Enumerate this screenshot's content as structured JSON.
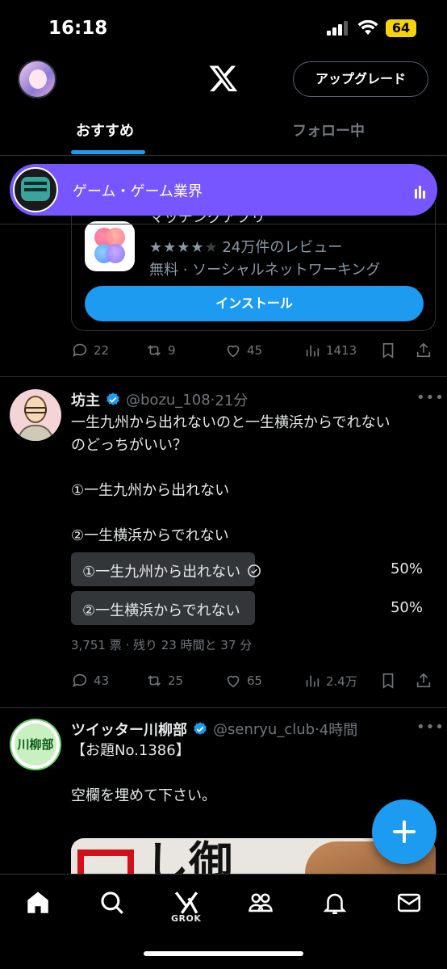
{
  "status": {
    "time": "16:18",
    "battery": "64"
  },
  "header": {
    "upgrade_label": "アップグレード"
  },
  "tabs": {
    "recommended": "おすすめ",
    "following": "フォロー中"
  },
  "space": {
    "title": "ゲーム・ゲーム業界"
  },
  "ad": {
    "cut_title": "マッチングアプリ",
    "rating_text": "24万件のレビュー",
    "rating": 4,
    "meta": "無料 · ソーシャルネットワーキング",
    "install_label": "インストール",
    "replies": "22",
    "reposts": "9",
    "likes": "45",
    "views": "1413"
  },
  "post1": {
    "name": "坊主",
    "handle": "@bozu_108",
    "time": "21分",
    "text_line1": "一生九州から出れないのと一生横浜からでれない",
    "text_line2": "のどっちがいい？",
    "option_text1": "①一生九州から出れない",
    "option_text2": "②一生横浜からでれない",
    "poll": [
      {
        "label": "①一生九州から出れない",
        "pct": "50%",
        "value": 50,
        "voted": true
      },
      {
        "label": "②一生横浜からでれない",
        "pct": "50%",
        "value": 50,
        "voted": false
      }
    ],
    "poll_meta": "3,751 票 · 残り 23 時間と 37 分",
    "replies": "43",
    "reposts": "25",
    "likes": "65",
    "views": "2.4万"
  },
  "post2": {
    "name": "ツイッター川柳部",
    "handle": "@senryu_club",
    "time": "4時間",
    "avatar_text": "川柳部",
    "line1": "【お題No.1386】",
    "line2": "空欄を埋めて下さい。",
    "image_kanji": "し御"
  },
  "nav": {
    "grok_label": "GROK"
  },
  "colors": {
    "accent": "#1d9bf0",
    "space": "#7856ff",
    "background": "#000000"
  }
}
